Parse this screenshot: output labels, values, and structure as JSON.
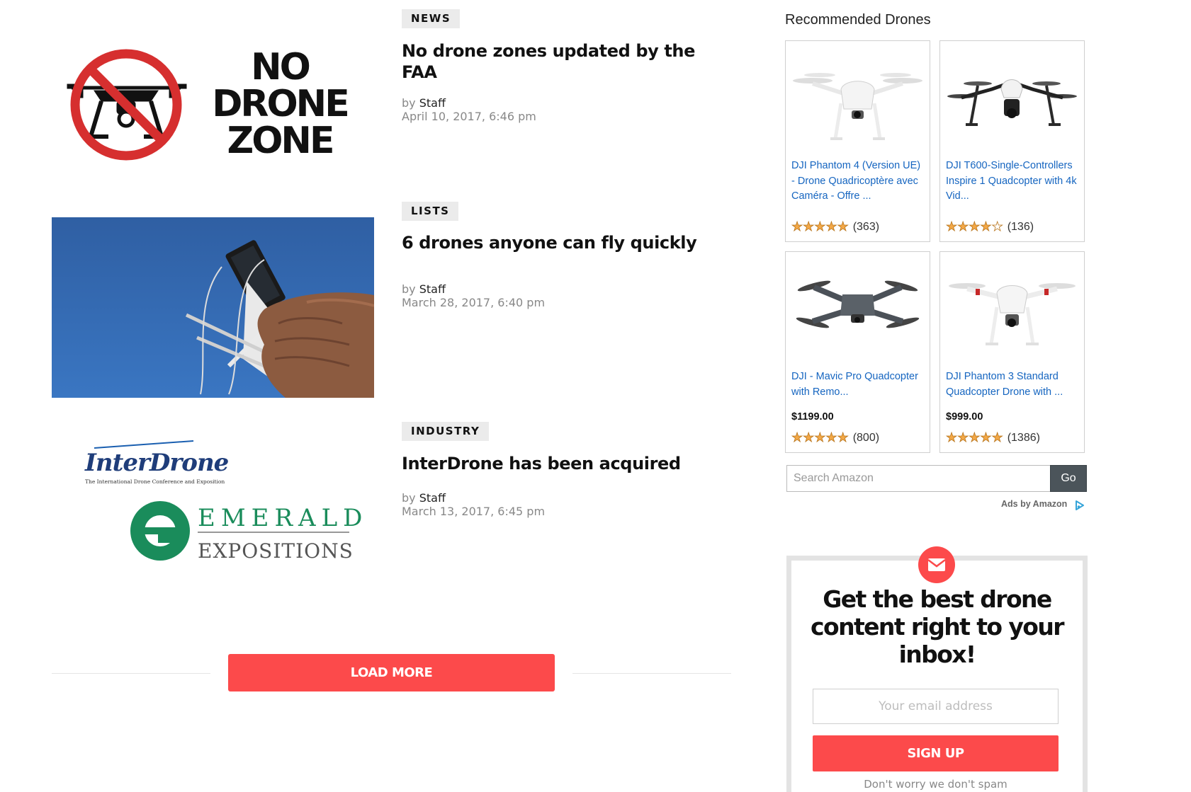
{
  "articles": [
    {
      "category": "NEWS",
      "title": "No drone zones updated by the FAA",
      "by": "by",
      "author": "Staff",
      "date": "April 10, 2017, 6:46 pm",
      "image": "no-drone-zone-sign",
      "image_text": [
        "NO",
        "DRONE",
        "ZONE"
      ]
    },
    {
      "category": "LISTS",
      "title": "6 drones anyone can fly quickly",
      "by": "by",
      "author": "Staff",
      "date": "March 28, 2017, 6:40 pm",
      "image": "hands-holding-drone-controller"
    },
    {
      "category": "INDUSTRY",
      "title": "InterDrone has been acquired",
      "by": "by",
      "author": "Staff",
      "date": "March 13, 2017, 6:45 pm",
      "image": "interdrone-emerald-logos",
      "image_text": {
        "logo1": "InterDrone",
        "logo1_sub": "The International Drone Conference and Exposition",
        "logo2_top": "EMERALD",
        "logo2_bottom": "EXPOSITIONS"
      }
    }
  ],
  "load_more": "LOAD MORE",
  "sidebar": {
    "recommended_title": "Recommended Drones",
    "products": [
      {
        "name": "DJI Phantom 4 (Version UE) - Drone Quadricoptère avec Caméra - Offre ...",
        "price": "",
        "rating": 4.5,
        "reviews": "(363)",
        "image": "white-quadcopter-phantom-icon"
      },
      {
        "name": "DJI T600-Single-Controllers Inspire 1 Quadcopter with 4k Vid...",
        "price": "",
        "rating": 4,
        "reviews": "(136)",
        "image": "inspire-drone-icon"
      },
      {
        "name": "DJI - Mavic Pro Quadcopter with Remo...",
        "price": "$1199.00",
        "rating": 4.5,
        "reviews": "(800)",
        "image": "grey-foldable-drone-icon"
      },
      {
        "name": "DJI Phantom 3 Standard Quadcopter Drone with ...",
        "price": "$999.00",
        "rating": 4.5,
        "reviews": "(1386)",
        "image": "white-red-quadcopter-icon"
      }
    ],
    "search_placeholder": "Search Amazon",
    "go_label": "Go",
    "ads_by": "Ads by Amazon",
    "newsletter": {
      "headline": "Get the best drone content right to your inbox!",
      "email_placeholder": "Your email address",
      "signup_label": "SIGN UP",
      "no_spam": "Don't worry we don't spam"
    }
  },
  "colors": {
    "accent_red": "#fc4a4b",
    "link_blue": "#1565c0",
    "star_orange": "#f3a847",
    "tag_grey": "#ebebeb"
  }
}
